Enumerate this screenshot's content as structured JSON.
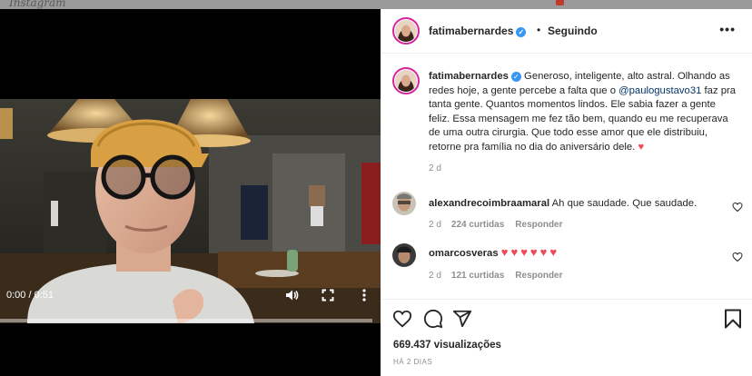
{
  "background": {
    "wordmark": "Instagram"
  },
  "video": {
    "time": "0:00 / 0:51",
    "progress_fraction": 0.0
  },
  "post": {
    "author": "fatimabernardes",
    "follow_status": "Seguindo",
    "caption": {
      "author": "fatimabernardes",
      "text_before_mention": " Generoso, inteligente, alto astral. Olhando as redes hoje, a gente percebe a falta que o ",
      "mention": "@paulogustavo31",
      "text_after_mention": " faz pra tanta gente. Quantos momentos lindos. Ele sabia fazer a gente feliz. Essa mensagem me fez tão bem, quando eu me recuperava de uma outra cirurgia. Que todo esse amor que ele distribuiu, retorne pra família no dia do aniversário dele. ",
      "age": "2 d"
    },
    "comments": [
      {
        "user": "alexandrecoimbraamaral",
        "text": "Ah que saudade. Que saudade.",
        "age": "2 d",
        "likes": "224 curtidas",
        "reply": "Responder"
      },
      {
        "user": "omarcosveras",
        "text": "♥♥♥♥♥♥",
        "age": "2 d",
        "likes": "121 curtidas",
        "reply": "Responder"
      }
    ],
    "views": "669.437 visualizações",
    "posted": "HÁ 2 DIAS"
  },
  "colors": {
    "verified": "#3897f0",
    "mention": "#00376b",
    "heart": "#ed4956",
    "muted": "#8e8e8e"
  }
}
